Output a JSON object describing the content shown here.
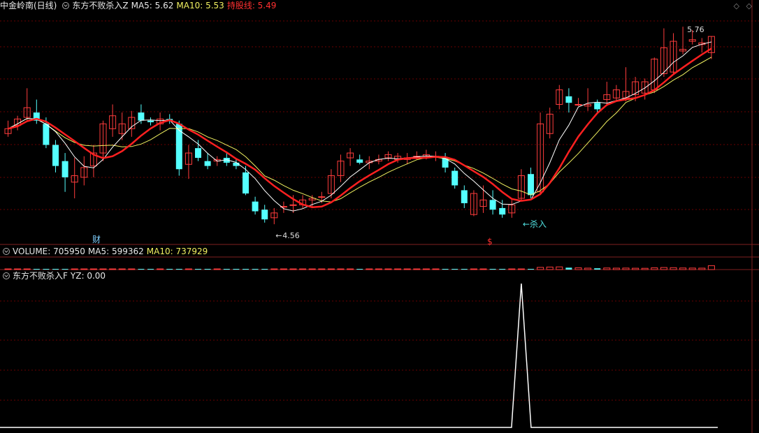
{
  "main_header": {
    "stock": "中金岭南(日线)",
    "indicator": "东方不败杀入Z",
    "ma5": "MA5: 5.62",
    "ma10": "MA10: 5.53",
    "hold": "持股线: 5.49"
  },
  "volume_header": {
    "label": "VOLUME: 705950",
    "ma5": "MA5: 599362",
    "ma10": "MA10: 737929"
  },
  "signal_header": {
    "label": "东方不败杀入F",
    "yz": "YZ: 0.00"
  },
  "annotations": {
    "high_label": "5.76",
    "low_label": "4.56",
    "signal_label": "←杀入",
    "cai": "财",
    "dollar": "$"
  },
  "colors": {
    "up": "#ff3c3c",
    "down": "#54ffff",
    "ma5": "#ffffff",
    "ma10": "#f0f060",
    "hold": "#ff2020",
    "grid": "#6a0000"
  },
  "chart_data": {
    "type": "candlestick",
    "title": "中金岭南(日线)",
    "ohlc": [
      [
        5.12,
        5.2,
        5.1,
        5.15
      ],
      [
        5.17,
        5.23,
        5.14,
        5.21
      ],
      [
        5.22,
        5.4,
        5.2,
        5.28
      ],
      [
        5.25,
        5.33,
        5.18,
        5.2
      ],
      [
        5.18,
        5.22,
        5.03,
        5.05
      ],
      [
        5.05,
        5.08,
        4.88,
        4.92
      ],
      [
        4.95,
        5.0,
        4.76,
        4.85
      ],
      [
        4.82,
        4.97,
        4.72,
        4.86
      ],
      [
        4.85,
        4.98,
        4.8,
        4.91
      ],
      [
        4.92,
        5.05,
        4.85,
        5.0
      ],
      [
        5.0,
        5.2,
        4.95,
        5.18
      ],
      [
        5.15,
        5.3,
        5.1,
        5.23
      ],
      [
        5.12,
        5.25,
        5.08,
        5.18
      ],
      [
        5.15,
        5.26,
        5.1,
        5.22
      ],
      [
        5.25,
        5.3,
        5.18,
        5.2
      ],
      [
        5.2,
        5.22,
        5.17,
        5.19
      ],
      [
        5.18,
        5.25,
        5.14,
        5.21
      ],
      [
        5.21,
        5.24,
        5.18,
        5.2
      ],
      [
        5.18,
        5.2,
        4.86,
        4.9
      ],
      [
        4.93,
        5.05,
        4.84,
        5.0
      ],
      [
        5.03,
        5.08,
        4.95,
        4.97
      ],
      [
        4.95,
        5.0,
        4.9,
        4.92
      ],
      [
        4.95,
        4.98,
        4.92,
        4.96
      ],
      [
        4.97,
        5.0,
        4.92,
        4.94
      ],
      [
        4.94,
        4.96,
        4.9,
        4.92
      ],
      [
        4.88,
        4.92,
        4.74,
        4.75
      ],
      [
        4.7,
        4.73,
        4.62,
        4.64
      ],
      [
        4.65,
        4.68,
        4.57,
        4.59
      ],
      [
        4.6,
        4.66,
        4.56,
        4.63
      ],
      [
        4.67,
        4.7,
        4.63,
        4.67
      ],
      [
        4.68,
        4.74,
        4.63,
        4.68
      ],
      [
        4.68,
        4.74,
        4.66,
        4.71
      ],
      [
        4.71,
        4.74,
        4.66,
        4.72
      ],
      [
        4.73,
        4.76,
        4.69,
        4.73
      ],
      [
        4.75,
        4.9,
        4.72,
        4.86
      ],
      [
        4.86,
        4.99,
        4.82,
        4.95
      ],
      [
        4.97,
        5.03,
        4.92,
        5.0
      ],
      [
        4.96,
        4.99,
        4.93,
        4.94
      ],
      [
        4.94,
        4.98,
        4.9,
        4.95
      ],
      [
        4.95,
        4.99,
        4.93,
        4.96
      ],
      [
        4.97,
        5.01,
        4.95,
        4.99
      ],
      [
        4.96,
        5.0,
        4.94,
        4.98
      ],
      [
        4.96,
        5.0,
        4.93,
        4.97
      ],
      [
        4.98,
        5.01,
        4.96,
        4.98
      ],
      [
        4.98,
        5.02,
        4.96,
        4.99
      ],
      [
        4.98,
        5.01,
        4.95,
        4.98
      ],
      [
        4.97,
        5.0,
        4.88,
        4.91
      ],
      [
        4.89,
        4.91,
        4.78,
        4.8
      ],
      [
        4.77,
        4.8,
        4.66,
        4.69
      ],
      [
        4.62,
        4.77,
        4.61,
        4.75
      ],
      [
        4.67,
        4.8,
        4.63,
        4.71
      ],
      [
        4.71,
        4.77,
        4.62,
        4.65
      ],
      [
        4.66,
        4.71,
        4.6,
        4.62
      ],
      [
        4.63,
        4.71,
        4.6,
        4.68
      ],
      [
        4.72,
        4.9,
        4.7,
        4.86
      ],
      [
        4.87,
        4.91,
        4.72,
        4.74
      ],
      [
        4.76,
        5.25,
        4.74,
        5.18
      ],
      [
        5.12,
        5.28,
        5.09,
        5.24
      ],
      [
        5.3,
        5.42,
        5.27,
        5.39
      ],
      [
        5.35,
        5.4,
        5.25,
        5.31
      ],
      [
        5.3,
        5.34,
        5.29,
        5.3
      ],
      [
        5.29,
        5.4,
        5.26,
        5.3
      ],
      [
        5.31,
        5.33,
        5.25,
        5.27
      ],
      [
        5.33,
        5.44,
        5.29,
        5.36
      ],
      [
        5.34,
        5.42,
        5.32,
        5.39
      ],
      [
        5.34,
        5.53,
        5.32,
        5.38
      ],
      [
        5.36,
        5.47,
        5.32,
        5.44
      ],
      [
        5.37,
        5.46,
        5.33,
        5.44
      ],
      [
        5.39,
        5.59,
        5.37,
        5.58
      ],
      [
        5.49,
        5.77,
        5.47,
        5.65
      ],
      [
        5.5,
        5.74,
        5.49,
        5.69
      ],
      [
        5.63,
        5.78,
        5.61,
        5.64
      ],
      [
        5.69,
        5.76,
        5.67,
        5.7
      ],
      [
        5.67,
        5.71,
        5.62,
        5.68
      ],
      [
        5.62,
        5.72,
        5.58,
        5.72
      ]
    ],
    "volume": [
      35000,
      40000,
      42000,
      38000,
      36000,
      30000,
      28000,
      30000,
      26000,
      32000,
      40000,
      38000,
      30000,
      28000,
      26000,
      24000,
      26000,
      24000,
      36000,
      30000,
      26000,
      24000,
      22000,
      24000,
      22000,
      28000,
      26000,
      24000,
      22000,
      22000,
      22000,
      24000,
      22000,
      22000,
      30000,
      32000,
      30000,
      24000,
      22000,
      24000,
      26000,
      24000,
      24000,
      22000,
      22000,
      22000,
      26000,
      28000,
      30000,
      34000,
      30000,
      28000,
      26000,
      28000,
      38000,
      40000,
      140000,
      160000,
      170000,
      120000,
      110000,
      90000,
      80000,
      100000,
      90000,
      95000,
      85000,
      80000,
      110000,
      130000,
      120000,
      100000,
      95000,
      90000,
      705950
    ],
    "signal": {
      "name": "东方不败杀入F",
      "index": 54,
      "value": 1,
      "yz": 0.0
    },
    "ma5_last": 5.62,
    "ma10_last": 5.53,
    "hold_last": 5.49,
    "volume_ma5": 599362,
    "volume_ma10": 737929,
    "ylim": [
      4.5,
      5.85
    ]
  }
}
